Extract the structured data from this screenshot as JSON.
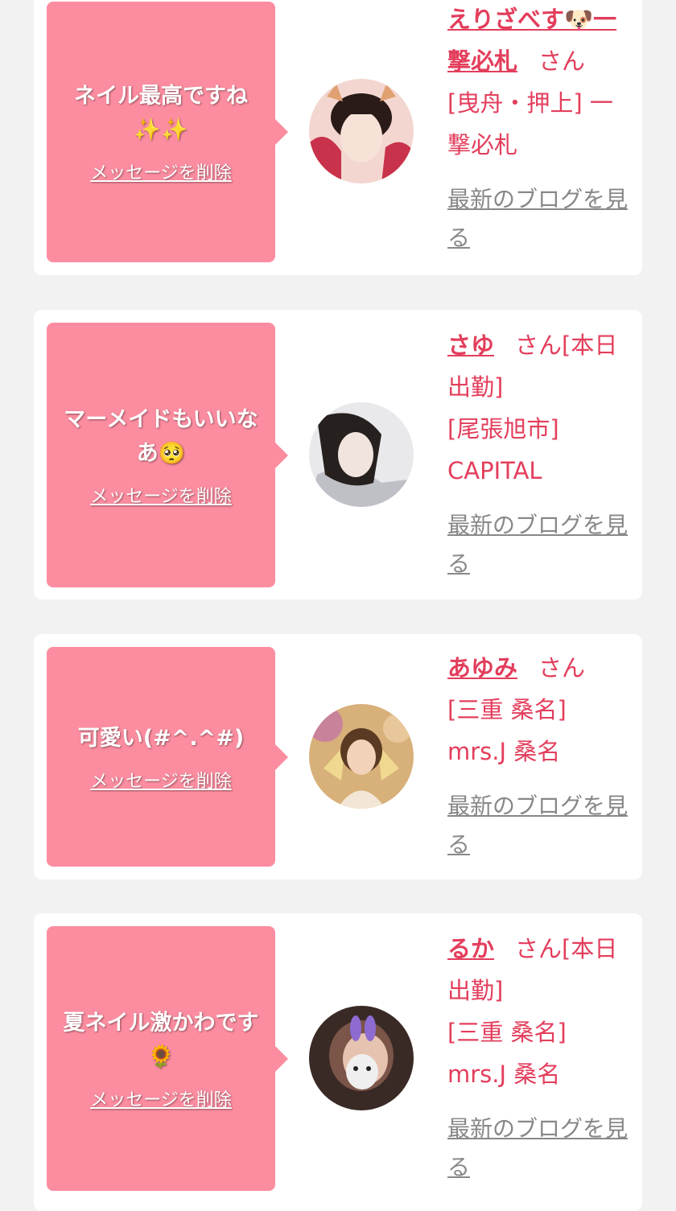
{
  "honorific": "さん",
  "delete_label": "メッセージを削除",
  "blog_label": "最新のブログを見る",
  "cards": [
    {
      "message": "ネイル最高ですね✨✨",
      "name": "えりざべす🐶一撃必札",
      "shop": "[曳舟・押上] 一撃必札",
      "avatar_colors": [
        "#f3d6d0",
        "#c8324a",
        "#2a1b18"
      ]
    },
    {
      "message": "マーメイドもいいなあ🥺",
      "name": "さゆ",
      "status": "[本日出勤]",
      "shop": "[尾張旭市] CAPITAL",
      "avatar_colors": [
        "#e9e9ec",
        "#bfbfc6",
        "#26201e"
      ]
    },
    {
      "message": "可愛い(#^.^#)",
      "name": "あゆみ",
      "shop": "[三重 桑名] mrs.J 桑名",
      "avatar_colors": [
        "#d8b07a",
        "#c8829a",
        "#5a3a22"
      ]
    },
    {
      "message": "夏ネイル激かわです🌻",
      "name": "るか",
      "status": "[本日出勤]",
      "shop": "[三重 桑名] mrs.J 桑名",
      "avatar_colors": [
        "#3a2a26",
        "#e6c3b0",
        "#8e6bd1"
      ]
    }
  ]
}
